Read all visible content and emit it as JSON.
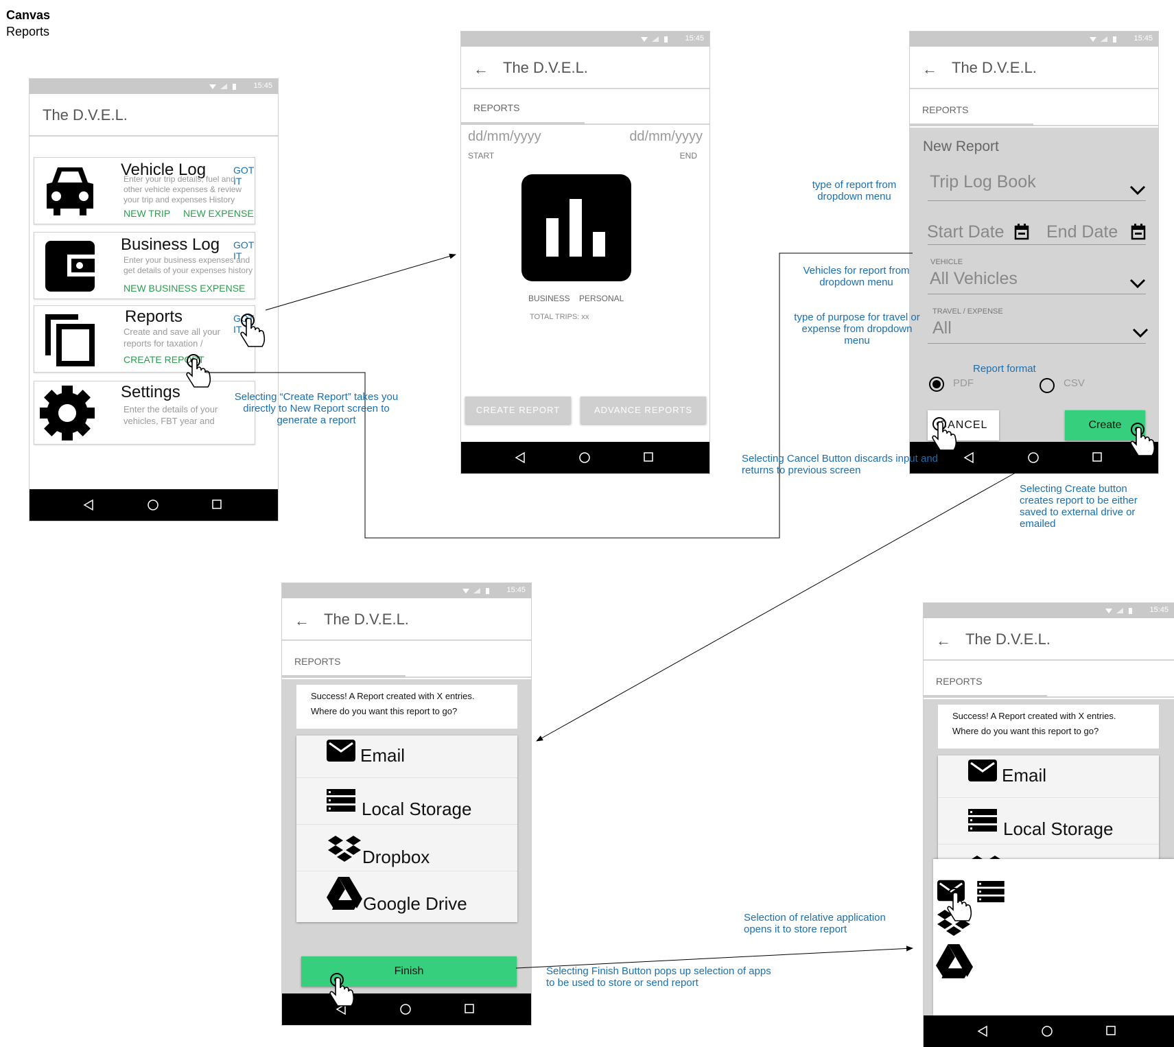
{
  "canvas": {
    "title": "Canvas",
    "subtitle": "Reports"
  },
  "common": {
    "status_time": "15:45",
    "app_title": "The D.V.E.L.",
    "tab_reports": "REPORTS",
    "nav": {
      "back": "back-icon",
      "home": "home-icon",
      "recents": "recents-icon"
    }
  },
  "home": {
    "cards": [
      {
        "title": "Vehicle Log",
        "got_it": "GOT IT",
        "desc": "Enter your trip details, fuel and other vehicle expenses & review your trip and expenses History",
        "actions": [
          "NEW TRIP",
          "NEW EXPENSE"
        ],
        "icon": "car-icon"
      },
      {
        "title": "Business Log",
        "got_it": "GOT IT",
        "desc": "Enter your business expenses and get details of your expenses history",
        "actions": [
          "NEW BUSINESS EXPENSE"
        ],
        "icon": "wallet-icon"
      },
      {
        "title": "Reports",
        "got_it": "GOT IT",
        "desc": "Create and save all your reports for taxation / business purpose",
        "actions": [
          "CREATE REPORT"
        ],
        "icon": "copy-icon"
      },
      {
        "title": "Settings",
        "got_it": "",
        "desc": "Enter the details of your vehicles, FBT year and",
        "actions": [],
        "icon": "gear-icon"
      }
    ]
  },
  "reports": {
    "start_placeholder": "dd/mm/yyyy",
    "end_placeholder": "dd/mm/yyyy",
    "start_label": "START",
    "end_label": "END",
    "legend_business": "BUSINESS",
    "legend_personal": "PERSONAL",
    "total_trips": "TOTAL TRIPS: xx",
    "create_report": "CREATE REPORT",
    "advance_reports": "ADVANCE REPORTS",
    "chart_icon": "bar-chart-icon"
  },
  "new_report": {
    "heading": "New Report",
    "report_type": "Trip Log Book",
    "start_date": "Start Date",
    "end_date": "End Date",
    "vehicle_label": "VEHICLE",
    "vehicle_value": "All Vehicles",
    "purpose_label": "TRAVEL /  EXPENSE",
    "purpose_value": "All",
    "format_label": "Report format",
    "format_pdf": "PDF",
    "format_csv": "CSV",
    "cancel": "CANCEL",
    "create": "Create"
  },
  "success": {
    "message_line1": "Success! A Report created with X entries.",
    "message_line2": "Where do you want this report to go?",
    "options": [
      {
        "label": "Email",
        "icon": "email-icon"
      },
      {
        "label": "Local Storage",
        "icon": "storage-icon"
      },
      {
        "label": "Dropbox",
        "icon": "dropbox-icon"
      },
      {
        "label": "Google Drive",
        "icon": "google-drive-icon"
      }
    ],
    "finish": "Finish"
  },
  "annotations": {
    "create_report": "Selecting “Create Report” takes you directly to New Report screen to generate a report",
    "type_of_report": "type of report from dropdown menu",
    "vehicles": "Vehicles for report from dropdown menu",
    "purpose": "type of purpose for travel or expense from dropdown menu",
    "cancel": "Selecting Cancel Button discards input and returns to previous screen",
    "create": "Selecting Create button creates report to be either saved to external drive or emailed",
    "finish": "Selecting Finish Button pops up selection of apps to be used to store or send report",
    "selection": "Selection of relative application opens it to store report"
  },
  "colors": {
    "accent_blue": "#1a6fb0",
    "green": "#36cf7d",
    "action_green": "#2a9d4e",
    "grey": "#c9c9c9"
  }
}
